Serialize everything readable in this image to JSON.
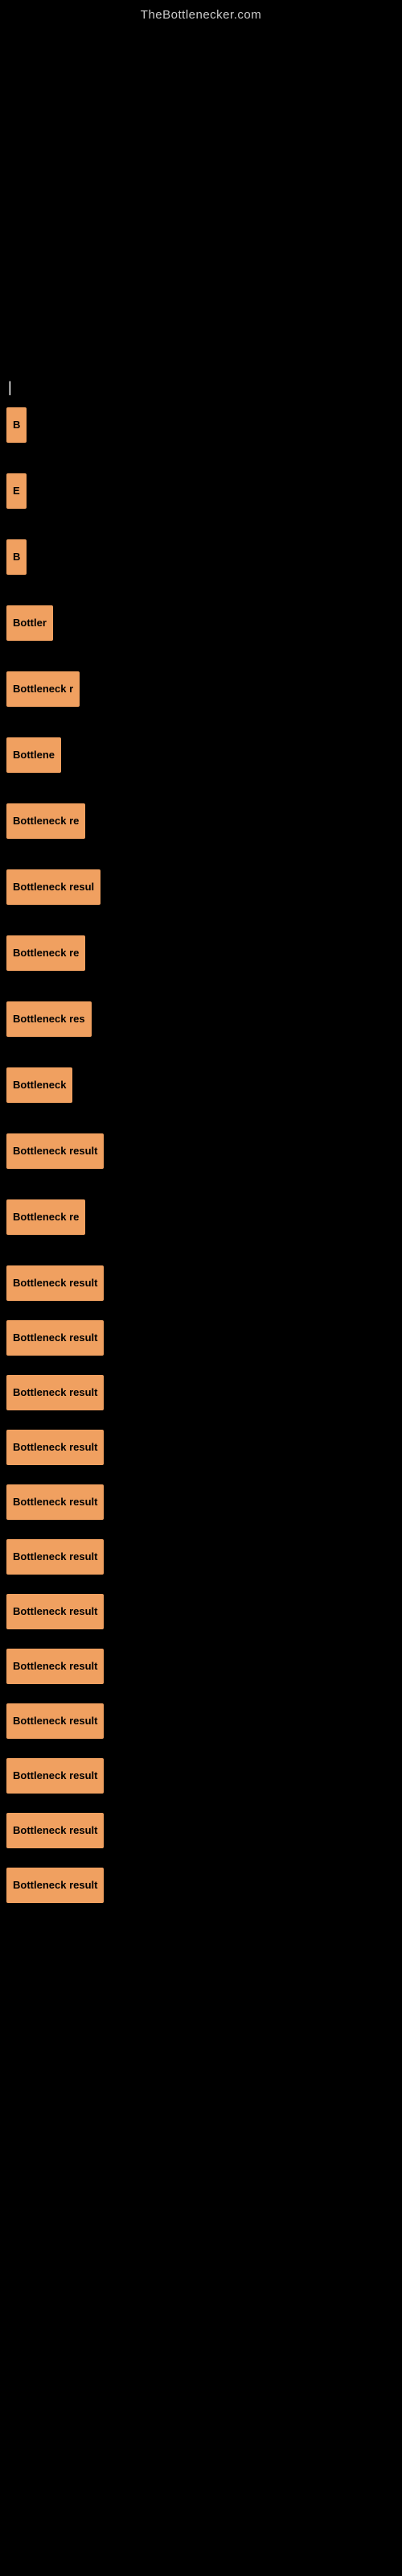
{
  "site": {
    "title": "TheBottlenecker.com"
  },
  "section": {
    "label": "|"
  },
  "items": [
    {
      "id": 1,
      "label": "B",
      "width": "short"
    },
    {
      "id": 2,
      "label": "E",
      "width": "short"
    },
    {
      "id": 3,
      "label": "B",
      "width": "short"
    },
    {
      "id": 4,
      "label": "Bottler",
      "width": "med3"
    },
    {
      "id": 5,
      "label": "Bottleneck r",
      "width": "long"
    },
    {
      "id": 6,
      "label": "Bottlene",
      "width": "med3"
    },
    {
      "id": 7,
      "label": "Bottleneck re",
      "width": "long"
    },
    {
      "id": 8,
      "label": "Bottleneck resul",
      "width": "longer"
    },
    {
      "id": 9,
      "label": "Bottleneck re",
      "width": "long"
    },
    {
      "id": 10,
      "label": "Bottleneck res",
      "width": "long"
    },
    {
      "id": 11,
      "label": "Bottleneck",
      "width": "med3"
    },
    {
      "id": 12,
      "label": "Bottleneck result",
      "width": "full"
    },
    {
      "id": 13,
      "label": "Bottleneck re",
      "width": "long"
    },
    {
      "id": 14,
      "label": "Bottleneck result",
      "width": "full"
    },
    {
      "id": 15,
      "label": "Bottleneck result",
      "width": "full"
    },
    {
      "id": 16,
      "label": "Bottleneck result",
      "width": "full"
    },
    {
      "id": 17,
      "label": "Bottleneck result",
      "width": "full"
    },
    {
      "id": 18,
      "label": "Bottleneck result",
      "width": "full"
    },
    {
      "id": 19,
      "label": "Bottleneck result",
      "width": "full"
    },
    {
      "id": 20,
      "label": "Bottleneck result",
      "width": "full"
    },
    {
      "id": 21,
      "label": "Bottleneck result",
      "width": "full"
    },
    {
      "id": 22,
      "label": "Bottleneck result",
      "width": "full"
    },
    {
      "id": 23,
      "label": "Bottleneck result",
      "width": "full"
    },
    {
      "id": 24,
      "label": "Bottleneck result",
      "width": "full"
    },
    {
      "id": 25,
      "label": "Bottleneck result",
      "width": "full"
    }
  ]
}
